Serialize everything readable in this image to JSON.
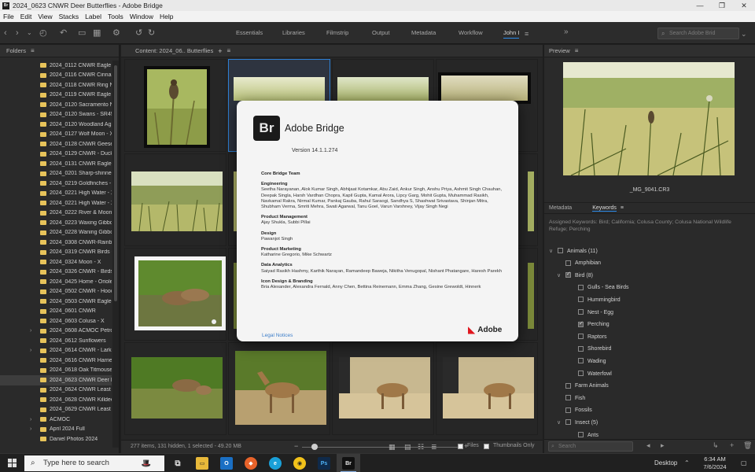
{
  "window": {
    "title": "2024_0623 CNWR Deer Butterflies - Adobe Bridge",
    "app_icon": "Br",
    "controls": [
      "—",
      "❐",
      "✕"
    ]
  },
  "menu": [
    "File",
    "Edit",
    "View",
    "Stacks",
    "Label",
    "Tools",
    "Window",
    "Help"
  ],
  "workspaces": [
    "Essentials",
    "Libraries",
    "Filmstrip",
    "Output",
    "Metadata",
    "Workflow",
    "John I"
  ],
  "active_workspace": "John I",
  "search_placeholder": "Search Adobe Brid",
  "folders": {
    "title": "Folders",
    "items": [
      {
        "label": "2024_0112 CNWR Eagle - ",
        "arrow": ""
      },
      {
        "label": "2024_0116 CNWR Cinnam",
        "arrow": ""
      },
      {
        "label": "2024_0118 CNWR Ring Ne",
        "arrow": ""
      },
      {
        "label": "2024_0119 CNWR Eagle - ",
        "arrow": ""
      },
      {
        "label": "2024_0120 Sacramento N",
        "arrow": ""
      },
      {
        "label": "2024_0120 Swans - SR45 ",
        "arrow": ""
      },
      {
        "label": "2024_0120 Woodland Ag",
        "arrow": ""
      },
      {
        "label": "2024_0127 Wolf Moon - X",
        "arrow": ""
      },
      {
        "label": "2024_0128 CNWR Geese &",
        "arrow": ""
      },
      {
        "label": "2024_0129 CNWR - Ducks",
        "arrow": ""
      },
      {
        "label": "2024_0131 CNWR Eagle - ",
        "arrow": ""
      },
      {
        "label": "2024_0201 Sharp-shinned",
        "arrow": ""
      },
      {
        "label": "2024_0219 Goldfinches - ",
        "arrow": ""
      },
      {
        "label": "2024_0221 High Water - X",
        "arrow": ""
      },
      {
        "label": "2024_0221 High Water - X",
        "arrow": ""
      },
      {
        "label": "2024_0222 River & Moon",
        "arrow": ""
      },
      {
        "label": "2024_0223 Waxing Gibbo",
        "arrow": ""
      },
      {
        "label": "2024_0228 Waning Gibbo",
        "arrow": ""
      },
      {
        "label": "2024_0308 CNWR-Rainbo",
        "arrow": ""
      },
      {
        "label": "2024_0319 CNWR Birds - ",
        "arrow": ""
      },
      {
        "label": "2024_0324 Moon - X",
        "arrow": ""
      },
      {
        "label": "2024_0326 CNWR - Birds",
        "arrow": ""
      },
      {
        "label": "2024_0425 Home - Oriole",
        "arrow": ""
      },
      {
        "label": "2024_0502 CNWR - Hood",
        "arrow": ""
      },
      {
        "label": "2024_0503 CNWR Eagle - ",
        "arrow": ""
      },
      {
        "label": "2024_0601 CNWR",
        "arrow": ""
      },
      {
        "label": "2024_0603 Colusa - X",
        "arrow": ""
      },
      {
        "label": "2024_0608 ACMOC Petrc",
        "arrow": "›"
      },
      {
        "label": "2024_0612 Sunflowers",
        "arrow": ""
      },
      {
        "label": "2024_0614 CNWR - Lark S",
        "arrow": "›"
      },
      {
        "label": "2024_0616 CNWR Harrier",
        "arrow": ""
      },
      {
        "label": "2024_0618 Oak Titmouse",
        "arrow": ""
      },
      {
        "label": "2024_0623 CNWR Deer B",
        "arrow": "",
        "selected": true
      },
      {
        "label": "2024_0624 CNWR Least E",
        "arrow": ""
      },
      {
        "label": "2024_0628 CNWR Killdeer",
        "arrow": ""
      },
      {
        "label": "2024_0629 CNWR Least B",
        "arrow": ""
      },
      {
        "label": "ACMOC",
        "arrow": "›"
      },
      {
        "label": "April 2024 Full",
        "arrow": "›"
      },
      {
        "label": "Daniel Photos 2024",
        "arrow": ""
      }
    ]
  },
  "content": {
    "title": "Content: 2024_06.. Butterflies",
    "status": "277 items, 131 hidden, 1 selected - 49.20 MB",
    "files_label": "Files",
    "thumbnails_only_label": "Thumbnails Only"
  },
  "preview": {
    "title": "Preview",
    "filename": "_MG_9041.CR3"
  },
  "metadata_tabs": [
    "Metadata",
    "Keywords"
  ],
  "assigned_keywords": "Assigned Keywords: Bird; California; Colusa County; Colusa National Wildlife Refuge; Perching",
  "keywords": [
    {
      "label": "Animals  (11)",
      "level": 0,
      "expand": "∨",
      "checked": false
    },
    {
      "label": "Amphibian",
      "level": 1,
      "expand": "",
      "checked": false
    },
    {
      "label": "Bird  (8)",
      "level": 1,
      "expand": "∨",
      "checked": true
    },
    {
      "label": "Gulls - Sea Birds",
      "level": 2,
      "expand": "",
      "checked": false
    },
    {
      "label": "Hummingbird",
      "level": 2,
      "expand": "",
      "checked": false
    },
    {
      "label": "Nest - Egg",
      "level": 2,
      "expand": "",
      "checked": false
    },
    {
      "label": "Perching",
      "level": 2,
      "expand": "",
      "checked": true
    },
    {
      "label": "Raptors",
      "level": 2,
      "expand": "",
      "checked": false
    },
    {
      "label": "Shorebird",
      "level": 2,
      "expand": "",
      "checked": false
    },
    {
      "label": "Wading",
      "level": 2,
      "expand": "",
      "checked": false
    },
    {
      "label": "Waterfowl",
      "level": 2,
      "expand": "",
      "checked": false
    },
    {
      "label": "Farm Animals",
      "level": 1,
      "expand": "",
      "checked": false
    },
    {
      "label": "Fish",
      "level": 1,
      "expand": "",
      "checked": false
    },
    {
      "label": "Fossils",
      "level": 1,
      "expand": "",
      "checked": false
    },
    {
      "label": "Insect  (5)",
      "level": 1,
      "expand": "∨",
      "checked": false
    },
    {
      "label": "Ants",
      "level": 2,
      "expand": "",
      "checked": false
    }
  ],
  "kw_search_placeholder": "Search",
  "about": {
    "logo": "Br",
    "app_name": "Adobe Bridge",
    "version": "Version 14.1.1.274",
    "sections": [
      {
        "heading": "Core Bridge Team",
        "text": ""
      },
      {
        "heading": "Engineering",
        "text": "Seetha Narayanan, Alok Kumar Singh, Abhijaat Kotamkar, Abu Zaid, Ankur Singh, Anshu Priya, Ashmit Singh Chauhan, Deepak Singla, Harsh Vardhan Chopra, Kapil Gupta, Kamal Arora, Lipcy Garg, Mohit Gupta, Muhammad Rasikh, Navkamal Rakra, Nirmal Kumar, Pankaj Gauba, Rahul Saraogi, Sandhya S, Shashwat Srivastava, Shinjan Mitra, Shubham Verma, Smriti Mehra, Swati Agarwal, Tanu Goel, Varun Varshney, Vijay Singh Negi"
      },
      {
        "heading": "Product Management",
        "text": "Ajay Shukla, Subbi Pillai"
      },
      {
        "heading": "Design",
        "text": "Pawanjot Singh"
      },
      {
        "heading": "Product Marketing",
        "text": "Katharine Gregorio, Mike Schwartz"
      },
      {
        "heading": "Data Analytics",
        "text": "Saiyad Rasikh Hashmy, Karthik Narayan, Ramandeep Baweja, Nikitha Venugopal, Nishant Phatangare, Haresh Parekh"
      },
      {
        "heading": "Icon Design & Branding",
        "text": "Bria Alexander, Alexandra Fernald, Anny Chen, Bettina Reinemann, Emma Zhang, Gesine Grewoldt, Hinnerk"
      }
    ],
    "legal": "Legal Notices",
    "brand": "Adobe"
  },
  "taskbar": {
    "search_placeholder": "Type here to search",
    "desktop_label": "Desktop",
    "time": "6:34 AM",
    "date": "7/6/2024"
  },
  "colors": {
    "accent": "#2d8ceb",
    "selection": "#2d7fd3",
    "adobe_red": "#e0161e",
    "folder": "#e7c35a"
  }
}
